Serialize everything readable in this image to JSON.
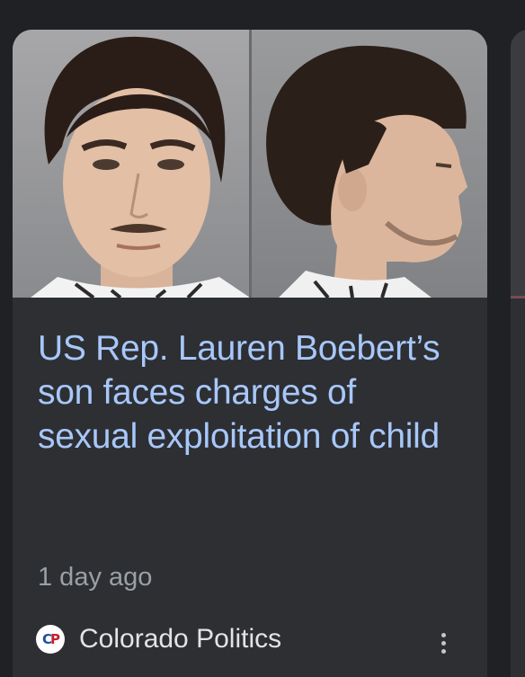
{
  "card": {
    "image": {
      "description_icon": "mugshot-photo",
      "panels": [
        "front-view-photo",
        "profile-view-photo"
      ]
    },
    "headline": "US Rep. Lauren Boebert’s son faces charges of sexual exploitation of child",
    "time_ago": "1 day ago",
    "source": {
      "logo_text_left": "C",
      "logo_text_right": "P",
      "name": "Colorado Politics"
    },
    "menu_icon": "more-vert-icon"
  },
  "colors": {
    "background": "#1f2124",
    "card": "#2d2f33",
    "headline": "#a8c7fa",
    "meta": "#9aa0a6",
    "source": "#e3e3e3",
    "logo_blue": "#1e4fa3",
    "logo_red": "#c4202e"
  }
}
